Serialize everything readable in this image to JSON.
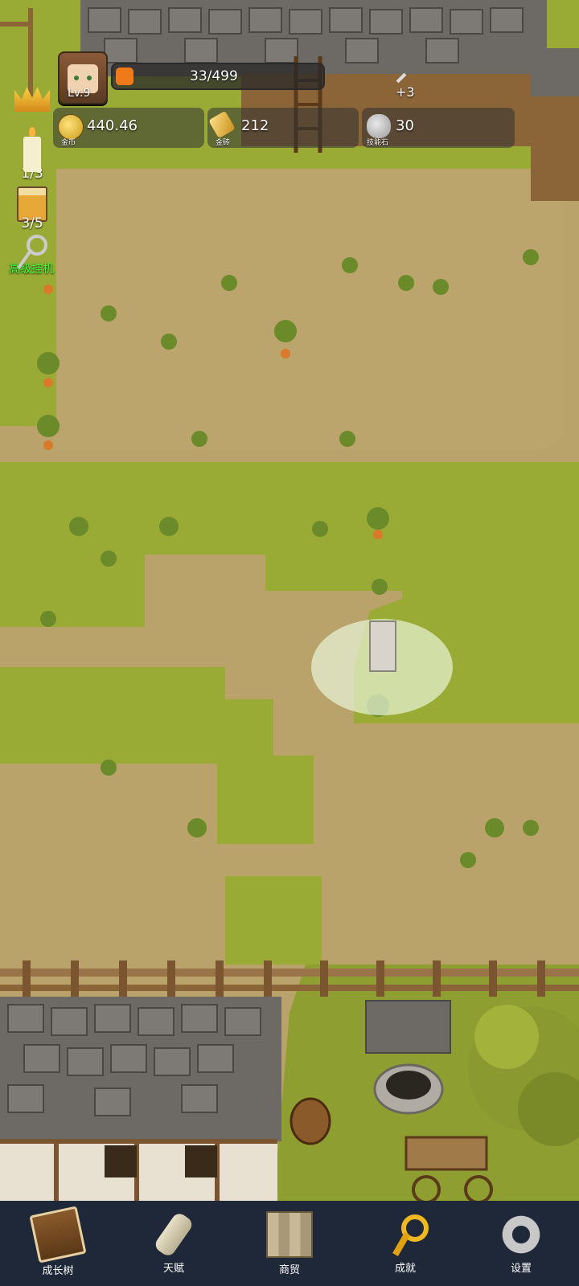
{
  "hud": {
    "level": "Lv.9",
    "xp": {
      "text": "33/499",
      "fraction": 0.066,
      "bonus": "+3"
    },
    "resources": [
      {
        "icon": "coin-icon",
        "value": "440.46",
        "caption": "金币"
      },
      {
        "icon": "gold-bar-icon",
        "value": "212",
        "caption": "金砖"
      },
      {
        "icon": "skill-stone-icon",
        "value": "30",
        "caption": "技能石"
      }
    ]
  },
  "side": {
    "crown": {
      "icon": "crown-icon"
    },
    "candle": {
      "icon": "candle-icon",
      "text": "1/3"
    },
    "mug": {
      "icon": "beer-mug-icon",
      "text": "3/5"
    },
    "auto": {
      "icon": "wrench-key-icon",
      "text": "高级挂机"
    }
  },
  "nav": [
    {
      "icon": "book-icon",
      "label": "成长树"
    },
    {
      "icon": "scroll-icon",
      "label": "天赋"
    },
    {
      "icon": "map-icon",
      "label": "商贸"
    },
    {
      "icon": "gold-key-icon",
      "label": "成就"
    },
    {
      "icon": "gear-icon",
      "label": "设置"
    }
  ],
  "colors": {
    "grass": "#9aab35",
    "dirt": "#b9a36a",
    "roof": "#6d6a66",
    "nav_bg": "#1f2838",
    "xp_fill": "#f07a1a"
  }
}
